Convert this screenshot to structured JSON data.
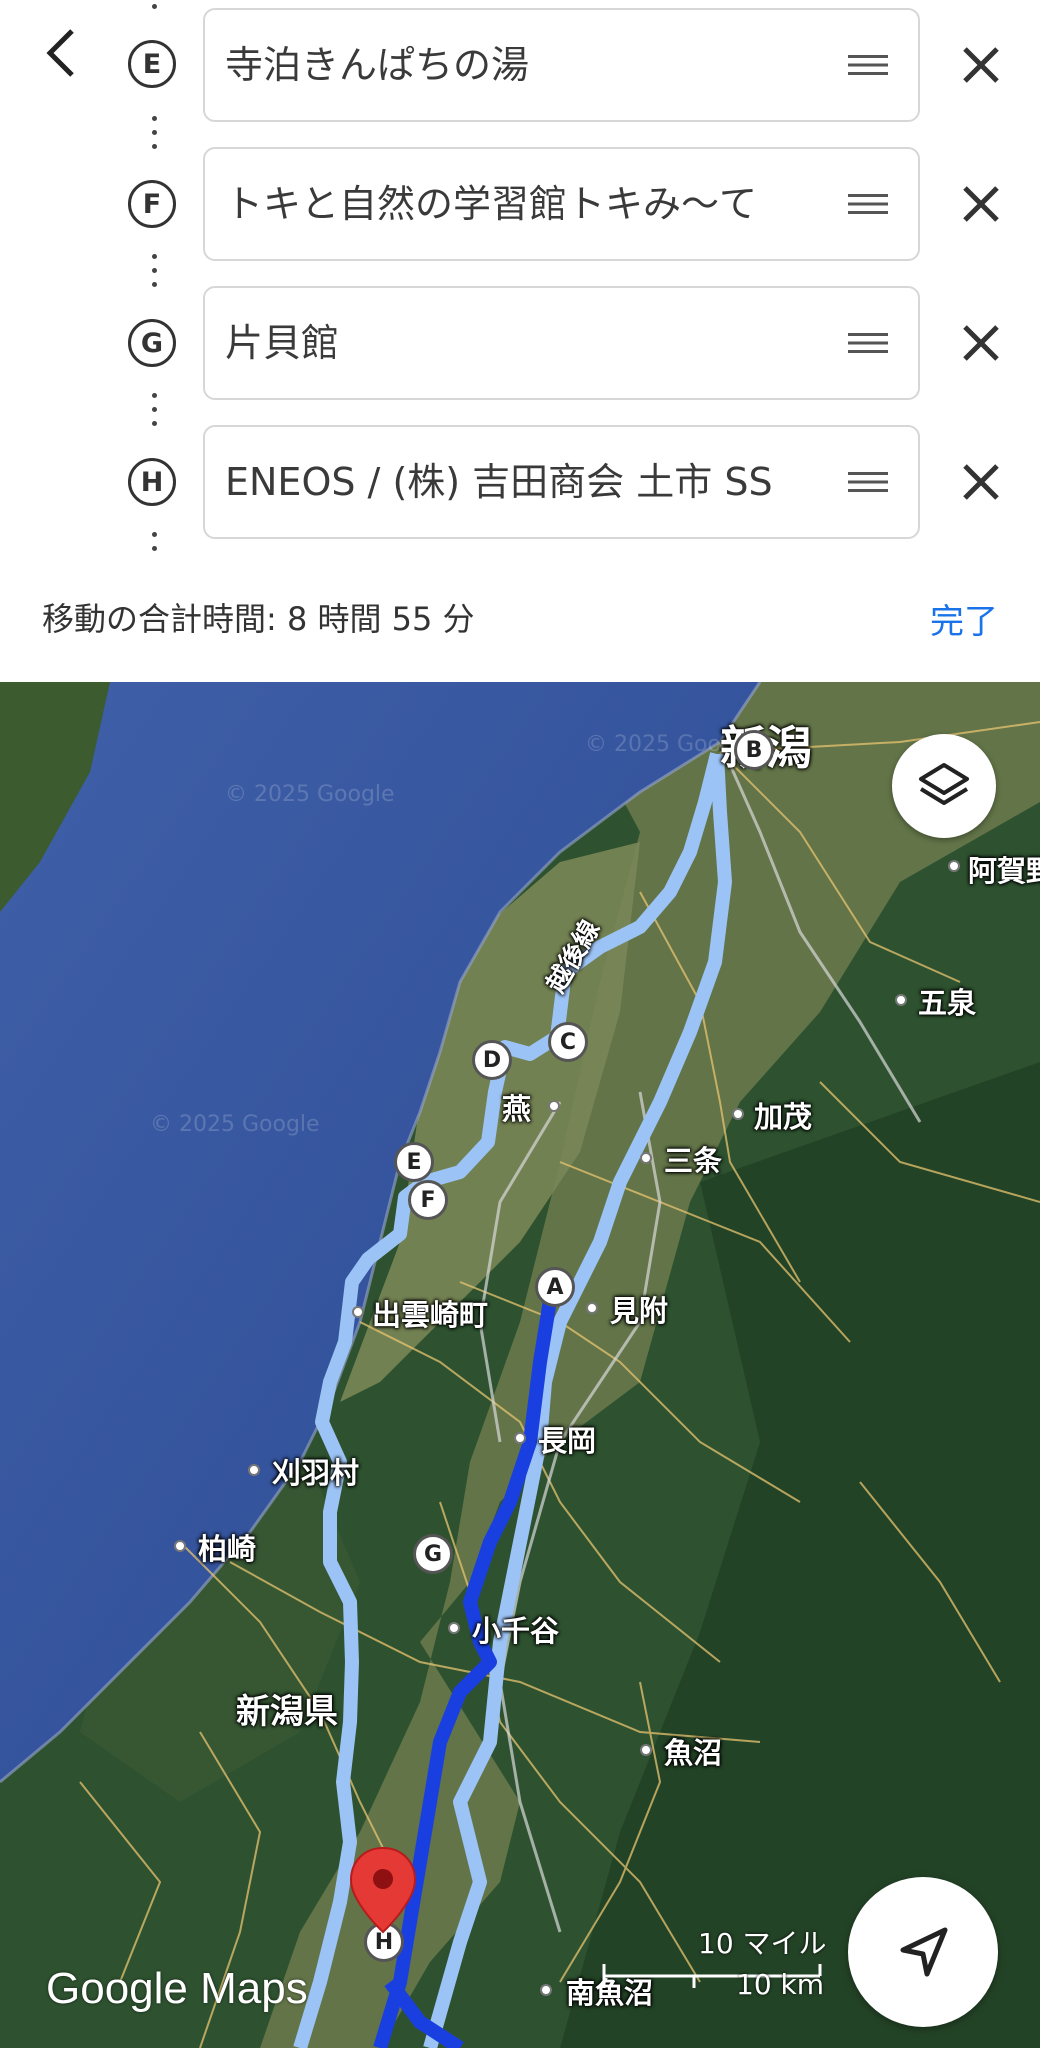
{
  "stops": [
    {
      "letter": "E",
      "name": "寺泊きんぱちの湯"
    },
    {
      "letter": "F",
      "name": "トキと自然の学習館トキみ〜て"
    },
    {
      "letter": "G",
      "name": "片貝館"
    },
    {
      "letter": "H",
      "name": "ENEOS / (株) 吉田商会 土市 SS"
    }
  ],
  "total_time": "移動の合計時間: 8 時間 55 分",
  "done_label": "完了",
  "map": {
    "cities": {
      "niigata": "新潟",
      "agano": "阿賀野",
      "gosen": "五泉",
      "kamo": "加茂",
      "sanjo": "三条",
      "tsubame": "燕",
      "mitsuke": "見附",
      "izumozaki": "出雲崎町",
      "nagaoka": "長岡",
      "kariwa": "刈羽村",
      "kashiwazaki": "柏崎",
      "ojiya": "小千谷",
      "uonuma": "魚沼",
      "minamiuonuma": "南魚沼",
      "prefecture": "新潟県",
      "rail_line": "越後線"
    },
    "markers": [
      "A",
      "B",
      "C",
      "D",
      "E",
      "F",
      "G",
      "H"
    ],
    "scale_miles": "10 マイル",
    "scale_km": "10 km",
    "brand": "Google Maps",
    "watermark": "© 2025 Google"
  },
  "icons": {
    "back": "chevron-left-icon",
    "drag": "drag-handle-icon",
    "remove": "close-icon",
    "layers": "layers-icon",
    "navigate": "navigation-arrow-icon",
    "pin": "destination-pin-icon"
  },
  "colors": {
    "accent": "#1a73e8",
    "route_primary": "#1a3fe0",
    "route_alternate": "#9cc3f5"
  }
}
